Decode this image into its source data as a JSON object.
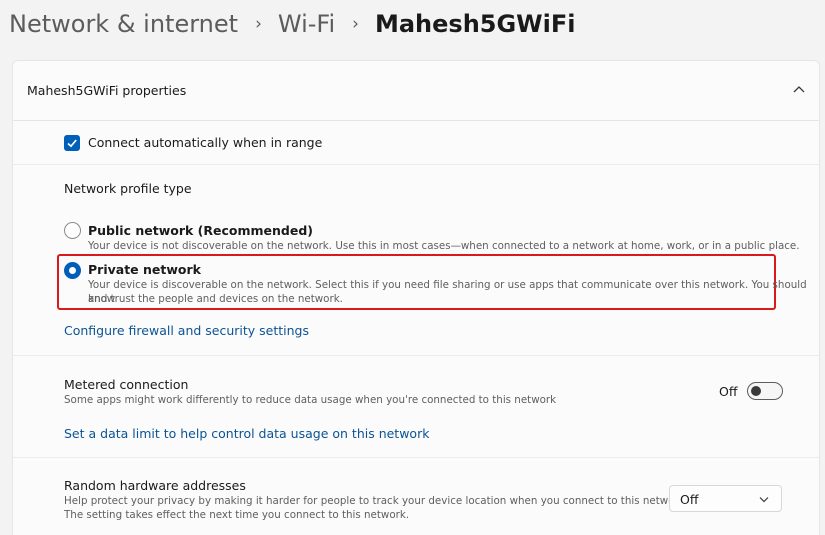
{
  "breadcrumb": {
    "items": [
      "Network & internet",
      "Wi-Fi"
    ],
    "current": "Mahesh5GWiFi",
    "separator": "›"
  },
  "card": {
    "title": "Mahesh5GWiFi properties",
    "collapse_icon": "chevron-up-icon",
    "connect_auto": {
      "label": "Connect automatically when in range",
      "checked": true
    },
    "profile_type_label": "Network profile type",
    "profiles": {
      "public": {
        "title": "Public network (Recommended)",
        "desc": "Your device is not discoverable on the network. Use this in most cases—when connected to a network at home, work, or in a public place.",
        "selected": false
      },
      "private": {
        "title": "Private network",
        "desc_line1": "Your device is discoverable on the network. Select this if you need file sharing or use apps that communicate over this network. You should know",
        "desc_line2": "and trust the people and devices on the network.",
        "selected": true
      }
    },
    "firewall_link": "Configure firewall and security settings",
    "metered": {
      "title": "Metered connection",
      "desc": "Some apps might work differently to reduce data usage when you're connected to this network",
      "toggle_label": "Off",
      "on": false
    },
    "data_limit_link": "Set a data limit to help control data usage on this network",
    "random_hw": {
      "title": "Random hardware addresses",
      "desc_line1": "Help protect your privacy by making it harder for people to track your device location when you connect to this network.",
      "desc_line2": "The setting takes effect the next time you connect to this network.",
      "dropdown_value": "Off"
    }
  },
  "colors": {
    "accent": "#005fb8",
    "link": "#0b5394",
    "highlight": "#d91a1a",
    "background": "#f3f3f3",
    "card": "#fbfbfb"
  }
}
